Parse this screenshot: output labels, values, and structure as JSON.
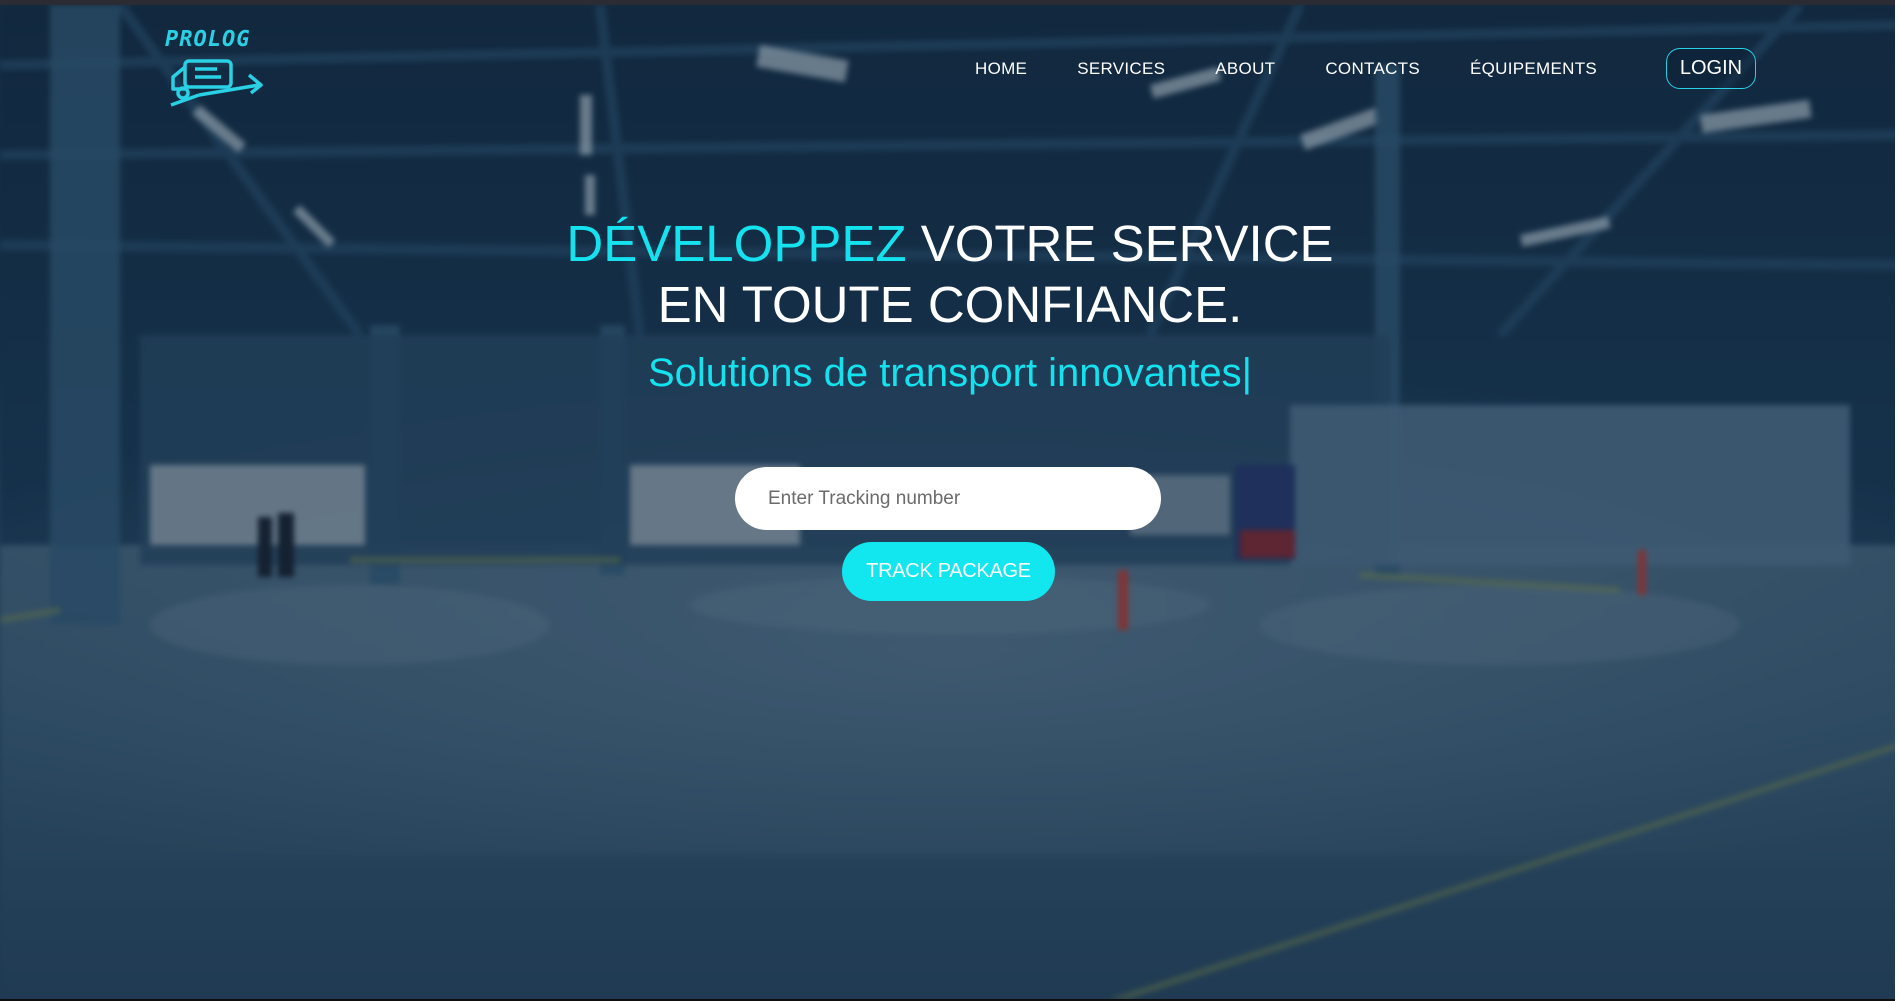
{
  "brand": {
    "logo_text": "PROLOG",
    "accent_color": "#14e3ef"
  },
  "nav": {
    "items": [
      {
        "label": "HOME"
      },
      {
        "label": "SERVICES"
      },
      {
        "label": "ABOUT"
      },
      {
        "label": "CONTACTS"
      },
      {
        "label": "ÉQUIPEMENTS"
      }
    ],
    "login_label": "LOGIN"
  },
  "hero": {
    "headline_accent": "DÉVELOPPEZ",
    "headline_rest_line1": "VOTRE SERVICE",
    "headline_line2": "EN TOUTE CONFIANCE.",
    "subtitle": "Solutions de transport innovantes|"
  },
  "tracking": {
    "placeholder": "Enter Tracking number",
    "value": "",
    "button_label": "TRACK PACKAGE"
  }
}
